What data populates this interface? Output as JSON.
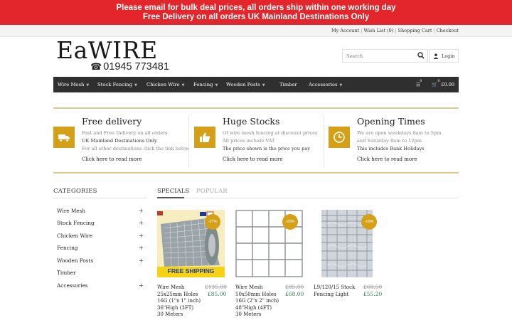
{
  "announcement": {
    "line1": "Please email for bulk deal prices, all orders ship within one working day",
    "line2": "Free Delivery on all orders UK Mainland Destinations Only"
  },
  "util_links": [
    "My Account",
    "Wish List (0)",
    "Shopping Cart",
    "Checkout"
  ],
  "logo": {
    "brand": "EaWIRE",
    "phone": "01945 773481"
  },
  "search": {
    "placeholder": "Search"
  },
  "login": {
    "label": "Login"
  },
  "nav": {
    "items": [
      {
        "label": "Wire Mesh",
        "caret": true
      },
      {
        "label": "Stock Fencing",
        "caret": true
      },
      {
        "label": "Chicken Wire",
        "caret": true
      },
      {
        "label": "Fencing",
        "caret": true
      },
      {
        "label": "Wooden Posts",
        "caret": true
      },
      {
        "label": "Timber",
        "caret": false
      },
      {
        "label": "Accessories",
        "caret": true
      }
    ],
    "compare_count": "0",
    "cart_count": "0",
    "cart_total": "£0.00"
  },
  "features": [
    {
      "icon": "truck-icon",
      "title": "Free delivery",
      "lines": [
        "Fast and Free Delivery on all orders",
        "UK Mainland Destinations Only",
        "For all other destinations click the link below"
      ],
      "link": "Click here to read more"
    },
    {
      "icon": "thumbs-up-icon",
      "title": "Huge Stocks",
      "lines": [
        "Of wire mesh fencing at discount prices",
        "All prices include VAT",
        "The price shown is the price you pay"
      ],
      "link": "Click here to read more"
    },
    {
      "icon": "clock-icon",
      "title": "Opening Times",
      "lines": [
        "We are open weekdays 8am to 5pm",
        "and Saturday 8am to 12pm",
        "This includes Bank Holidays"
      ],
      "link": "Click here to read more"
    }
  ],
  "categories": {
    "heading": "CATEGORIES",
    "items": [
      {
        "label": "Wire Mesh",
        "expandable": true
      },
      {
        "label": "Stock Fencing",
        "expandable": true
      },
      {
        "label": "Chicken Wire",
        "expandable": true
      },
      {
        "label": "Fencing",
        "expandable": true
      },
      {
        "label": "Wooden Posts",
        "expandable": true
      },
      {
        "label": "Timber",
        "expandable": false
      },
      {
        "label": "Accessories",
        "expandable": true
      }
    ]
  },
  "tabs": {
    "specials": "SPECIALS",
    "popular": "POPULAR"
  },
  "products": [
    {
      "name": "Wire Mesh 25x25mm Holes 16G (1\"x 1\" inch) 36\"High (3FT) 30 Meters",
      "old_price": "£135.00",
      "new_price": "£85.00",
      "badge": "-37%",
      "image_text": "FREE SHIPPING"
    },
    {
      "name": "Wire Mesh 50x50mm Holes 16G (2\"x 2\" inch) 48\"High (4FT) 30 Meters",
      "old_price": "£85.00",
      "new_price": "£68.00",
      "badge": "-20%"
    },
    {
      "name": "L9/120/15 Stock Fencing Light",
      "old_price": "£68.50",
      "new_price": "£55.20",
      "badge": "-19%"
    }
  ]
}
